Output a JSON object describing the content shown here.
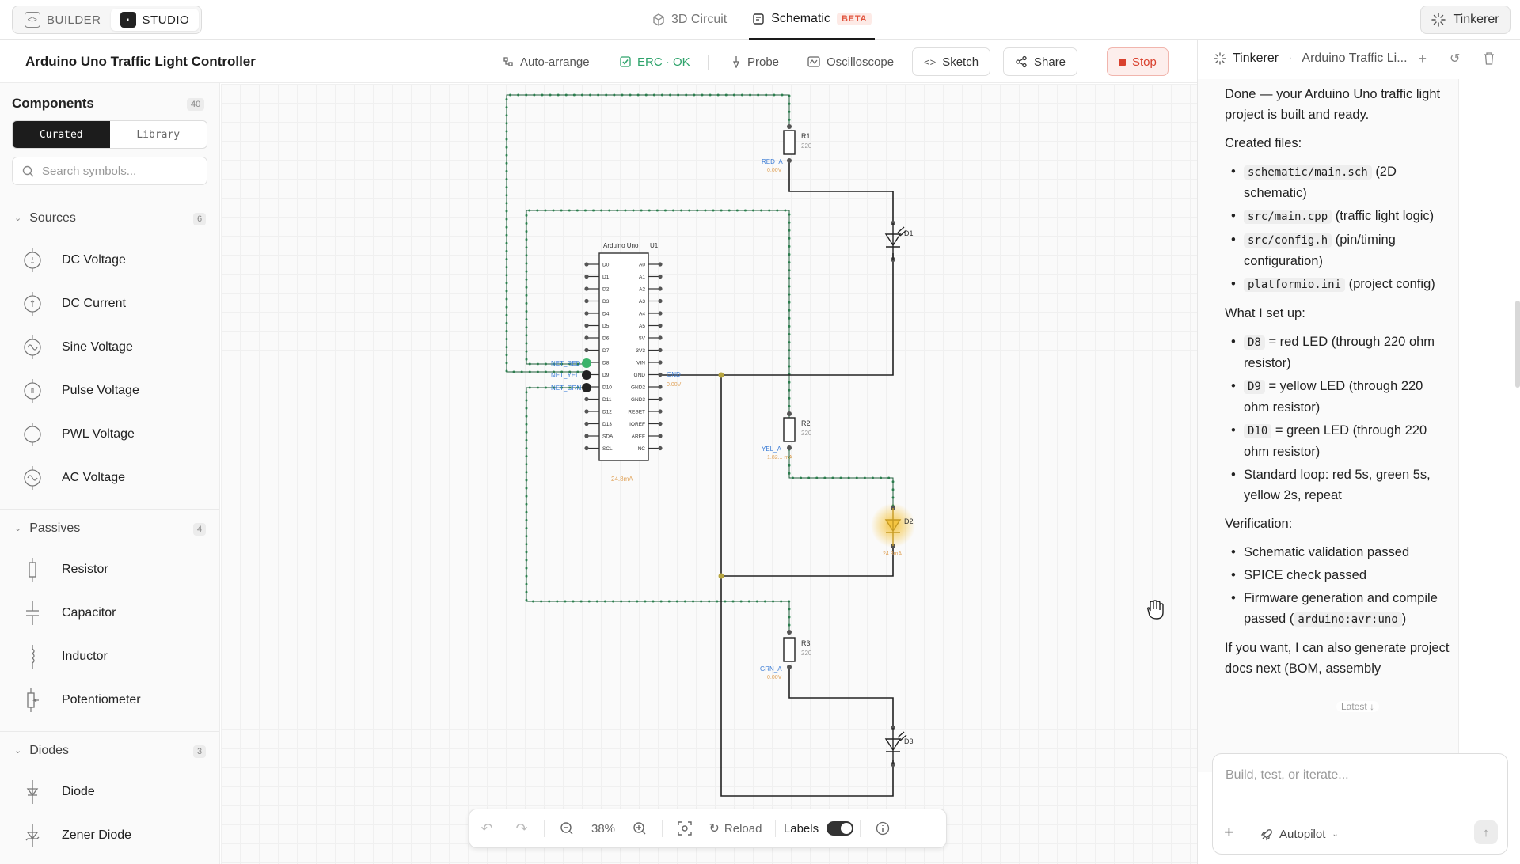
{
  "modes": {
    "builder": "BUILDER",
    "studio": "STUDIO"
  },
  "tabs": {
    "circuit3d": "3D Circuit",
    "schematic": "Schematic",
    "beta": "BETA"
  },
  "tinker_button": "Tinkerer",
  "project_title": "Arduino Uno Traffic Light Controller",
  "toolbar": {
    "auto_arrange": "Auto-arrange",
    "erc": "ERC · OK",
    "probe": "Probe",
    "oscilloscope": "Oscilloscope",
    "sketch": "Sketch",
    "share": "Share",
    "stop": "Stop"
  },
  "components": {
    "title": "Components",
    "count": "40",
    "tab_curated": "Curated",
    "tab_library": "Library",
    "search_placeholder": "Search symbols...",
    "sections": [
      {
        "name": "Sources",
        "count": "6",
        "items": [
          "DC Voltage",
          "DC Current",
          "Sine Voltage",
          "Pulse Voltage",
          "PWL Voltage",
          "AC Voltage"
        ]
      },
      {
        "name": "Passives",
        "count": "4",
        "items": [
          "Resistor",
          "Capacitor",
          "Inductor",
          "Potentiometer"
        ]
      },
      {
        "name": "Diodes",
        "count": "3",
        "items": [
          "Diode",
          "Zener Diode"
        ]
      }
    ]
  },
  "schematic": {
    "mcu_name": "Arduino Uno",
    "mcu_ref": "U1",
    "left_pins": [
      "D0",
      "D1",
      "D2",
      "D3",
      "D4",
      "D5",
      "D6",
      "D7",
      "D8",
      "D9",
      "D10",
      "D11",
      "D12",
      "D13",
      "SDA",
      "SCL"
    ],
    "right_pins": [
      "A0",
      "A1",
      "A2",
      "A3",
      "A4",
      "A5",
      "5V",
      "3V3",
      "VIN",
      "GND",
      "GND2",
      "GND3",
      "RESET",
      "IOREF",
      "AREF",
      "NC"
    ],
    "net_labels": [
      "NET_RED",
      "NET_YEL",
      "NET_GRN"
    ],
    "gnd_label": "GND",
    "gnd_voltage": "0.00V",
    "mcu_current": "24.8mA",
    "resistors": [
      {
        "ref": "R1",
        "value": "220",
        "net": "RED_A",
        "reading": "0.00V"
      },
      {
        "ref": "R2",
        "value": "220",
        "net": "YEL_A",
        "reading": "1.82... mA"
      },
      {
        "ref": "R3",
        "value": "220",
        "net": "GRN_A",
        "reading": "0.00V"
      }
    ],
    "leds": [
      {
        "ref": "D1",
        "lit": false
      },
      {
        "ref": "D2",
        "lit": true,
        "reading": "24.8mA"
      },
      {
        "ref": "D3",
        "lit": false
      }
    ],
    "wire_color": "#3d9a62",
    "glow_color": "#f5c542"
  },
  "zoom": {
    "level": "38%",
    "reload": "Reload",
    "labels": "Labels",
    "labels_on": true
  },
  "assistant": {
    "name": "Tinkerer",
    "thread": "Arduino Traffic Li...",
    "intro": "Done — your Arduino Uno traffic light project is built and ready.",
    "files_heading": "Created files:",
    "files": [
      {
        "code": "schematic/main.sch",
        "desc": "(2D schematic)"
      },
      {
        "code": "src/main.cpp",
        "desc": "(traffic light logic)"
      },
      {
        "code": "src/config.h",
        "desc": "(pin/timing configuration)"
      },
      {
        "code": "platformio.ini",
        "desc": "(project config)"
      }
    ],
    "setup_heading": "What I set up:",
    "setup": [
      {
        "code": "D8",
        "desc": "= red LED (through 220 ohm resistor)"
      },
      {
        "code": "D9",
        "desc": "= yellow LED (through 220 ohm resistor)"
      },
      {
        "code": "D10",
        "desc": "= green LED (through 220 ohm resistor)"
      },
      {
        "code": "",
        "desc": "Standard loop: red 5s, green 5s, yellow 2s, repeat"
      }
    ],
    "verify_heading": "Verification:",
    "verify": [
      "Schematic validation passed",
      "SPICE check passed",
      "Firmware generation and compile passed"
    ],
    "compile_target": "arduino:avr:uno",
    "outro": "If you want, I can also generate project docs next (BOM, assembly",
    "latest": "Latest",
    "composer_placeholder": "Build, test, or iterate...",
    "autopilot": "Autopilot"
  }
}
